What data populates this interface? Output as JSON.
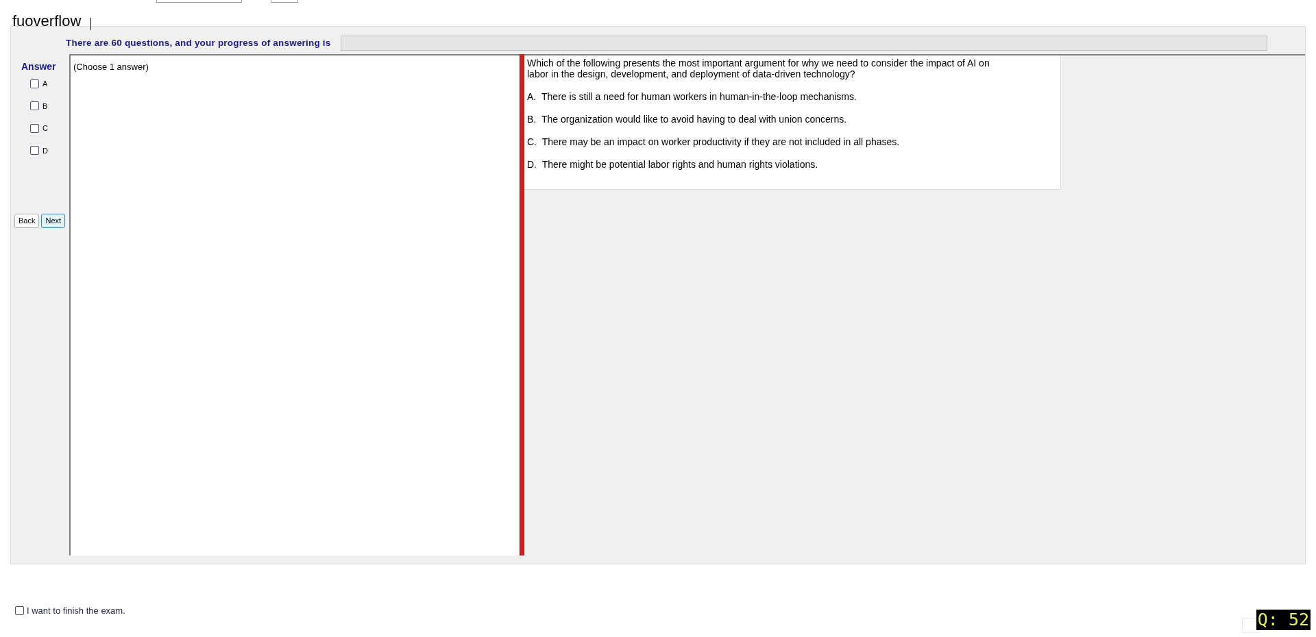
{
  "app_title": "fuoverflow",
  "progress": {
    "label": "There are 60 questions, and your progress of answering is",
    "level": 0
  },
  "answer_panel": {
    "title": "Answer",
    "options": [
      {
        "label": "A",
        "checked": false
      },
      {
        "label": "B",
        "checked": false
      },
      {
        "label": "C",
        "checked": false
      },
      {
        "label": "D",
        "checked": false
      }
    ]
  },
  "buttons": [
    {
      "label": "Back",
      "selected": false
    },
    {
      "label": "Next",
      "selected": true
    }
  ],
  "instruction": "(Choose 1 answer)",
  "question": {
    "text": "Which of the following presents the most important argument for why we need to consider the impact of AI on labor in the design, development, and deployment of data-driven technology?",
    "choices": [
      {
        "letter": "A.",
        "text": "There is still a need for human workers in human-in-the-loop mechanisms."
      },
      {
        "letter": "B.",
        "text": "The organization would like to avoid having to deal with union concerns."
      },
      {
        "letter": "C.",
        "text": "There may be an impact on worker productivity if they are not included in all phases."
      },
      {
        "letter": "D.",
        "text": "There might be potential labor rights and human rights violations."
      }
    ]
  },
  "finish": {
    "label": "I want to finish the exam.",
    "checked": false
  },
  "question_number": "Q: 52"
}
